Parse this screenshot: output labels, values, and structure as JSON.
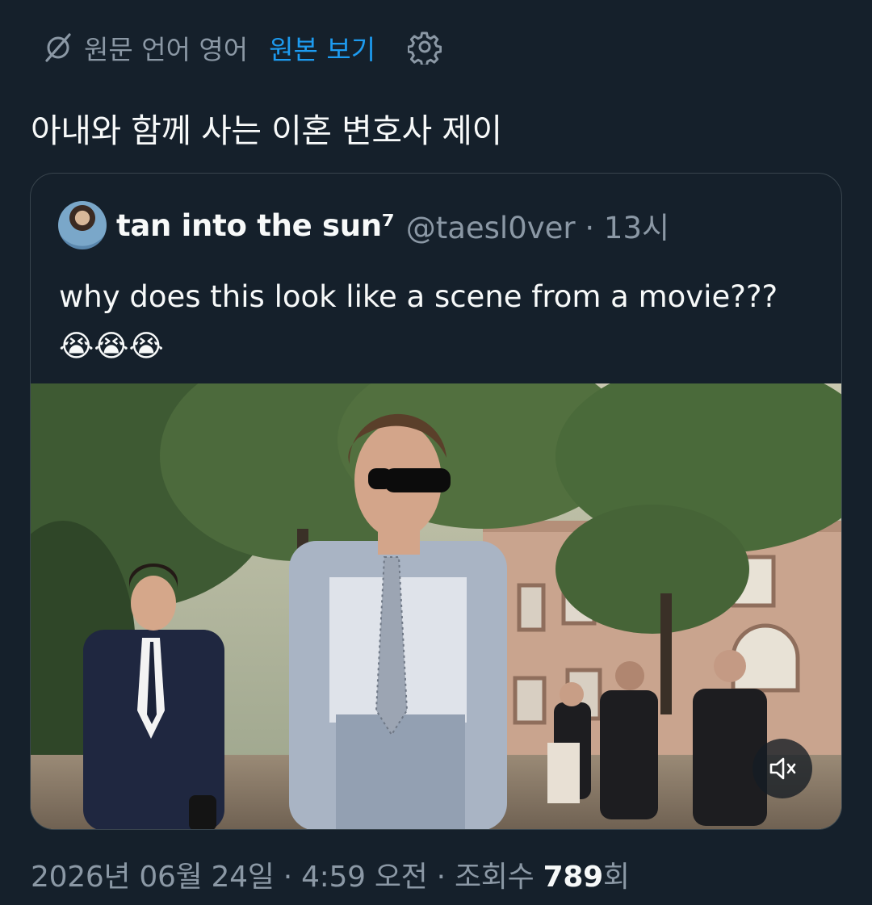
{
  "translation_bar": {
    "icon": "translate-icon",
    "label": "원문 언어 영어",
    "show_original": "원본 보기",
    "settings_icon": "gear-icon"
  },
  "tweet": {
    "text": "아내와 함께 사는 이혼 변호사 제이"
  },
  "quote": {
    "display_name": "tan into the sun⁷",
    "handle": "@taesl0ver",
    "separator": "·",
    "time": "13시",
    "text": "why does this look like a scene from a movie??? 😭😭😭",
    "media": {
      "type": "video",
      "mute_icon": "muted-speaker-icon"
    }
  },
  "meta": {
    "date": "2026년 06월 24일",
    "sep1": "·",
    "time": "4:59 오전",
    "sep2": "·",
    "views_label": "조회수",
    "views_count": "789",
    "views_suffix": "회"
  },
  "colors": {
    "background": "#15202b",
    "accent": "#1d9bf0",
    "secondary_text": "#8b98a5",
    "border": "#38444d"
  }
}
